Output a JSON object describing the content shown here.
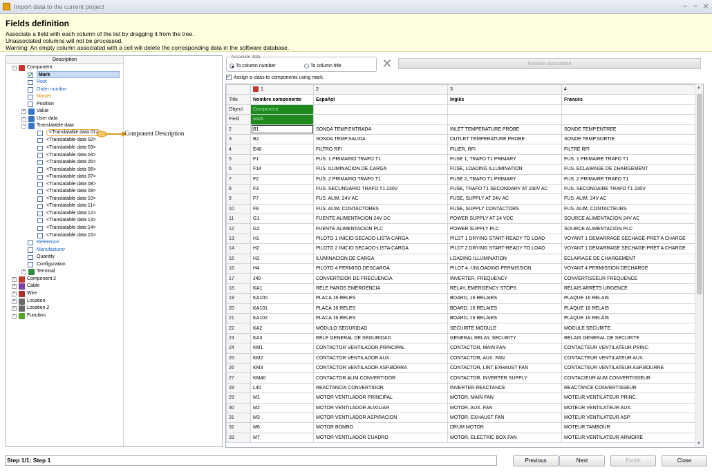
{
  "window": {
    "title": "Import data to the current project",
    "controls": [
      "–",
      "▫",
      "✕"
    ]
  },
  "header": {
    "title": "Fields definition",
    "lines": [
      "Associate a field with each column of the list by dragging it from the tree.",
      "Unassociated columns will not be processed.",
      "Warning: An empty column associated with a cell will delete the corresponding data in the software database."
    ]
  },
  "tree": {
    "column_header": "Description",
    "items": [
      {
        "label": "Component",
        "level": 0,
        "exp": "−",
        "icon": "component-icon",
        "color": "#c0392b"
      },
      {
        "label": "Mark",
        "level": 1,
        "cb": "checked",
        "style": "sel"
      },
      {
        "label": "Root",
        "level": 1,
        "cb": "empty",
        "style": "blue"
      },
      {
        "label": "Order number",
        "level": 1,
        "cb": "empty",
        "style": "blue"
      },
      {
        "label": "Master",
        "level": 1,
        "cb": "empty",
        "style": "orange"
      },
      {
        "label": "Position",
        "level": 1,
        "cb": "empty"
      },
      {
        "label": "Value",
        "level": 1,
        "exp": "+",
        "icon": "folder-icon",
        "color": "#3a74c6"
      },
      {
        "label": "User data",
        "level": 1,
        "exp": "+",
        "icon": "folder-icon",
        "color": "#3a74c6"
      },
      {
        "label": "Translatable data",
        "level": 1,
        "exp": "−",
        "icon": "folder-icon",
        "color": "#3a74c6"
      },
      {
        "label": "<Translatable data 01>",
        "level": 2,
        "cb": "empty",
        "style": "outlined"
      },
      {
        "label": "<Translatable data 02>",
        "level": 2,
        "cb": "empty"
      },
      {
        "label": "<Translatable data 03>",
        "level": 2,
        "cb": "empty"
      },
      {
        "label": "<Translatable data 04>",
        "level": 2,
        "cb": "empty"
      },
      {
        "label": "<Translatable data 05>",
        "level": 2,
        "cb": "empty"
      },
      {
        "label": "<Translatable data 06>",
        "level": 2,
        "cb": "empty"
      },
      {
        "label": "<Translatable data 07>",
        "level": 2,
        "cb": "empty"
      },
      {
        "label": "<Translatable data 08>",
        "level": 2,
        "cb": "empty"
      },
      {
        "label": "<Translatable data 09>",
        "level": 2,
        "cb": "empty"
      },
      {
        "label": "<Translatable data 10>",
        "level": 2,
        "cb": "empty"
      },
      {
        "label": "<Translatable data 11>",
        "level": 2,
        "cb": "empty"
      },
      {
        "label": "<Translatable data 12>",
        "level": 2,
        "cb": "empty"
      },
      {
        "label": "<Translatable data 13>",
        "level": 2,
        "cb": "empty"
      },
      {
        "label": "<Translatable data 14>",
        "level": 2,
        "cb": "empty"
      },
      {
        "label": "<Translatable data 15>",
        "level": 2,
        "cb": "empty"
      },
      {
        "label": "Reference",
        "level": 1,
        "cb": "empty",
        "style": "blue"
      },
      {
        "label": "Manufacturer",
        "level": 1,
        "cb": "empty",
        "style": "blue"
      },
      {
        "label": "Quantity",
        "level": 1,
        "cb": "empty"
      },
      {
        "label": "Configuration",
        "level": 1,
        "cb": "empty"
      },
      {
        "label": "Terminal",
        "level": 1,
        "exp": "+",
        "icon": "terminal-icon",
        "color": "#2f8a3c"
      },
      {
        "label": "Component 2",
        "level": 0,
        "exp": "+",
        "icon": "component-icon",
        "color": "#c0392b"
      },
      {
        "label": "Cable",
        "level": 0,
        "exp": "+",
        "icon": "cable-icon",
        "color": "#7a3fa0"
      },
      {
        "label": "Wire",
        "level": 0,
        "exp": "+",
        "icon": "wire-icon",
        "color": "#b03030"
      },
      {
        "label": "Location",
        "level": 0,
        "exp": "+",
        "icon": "location-icon",
        "color": "#6a6a6a"
      },
      {
        "label": "Location 2",
        "level": 0,
        "exp": "+",
        "icon": "location-icon",
        "color": "#6a6a6a"
      },
      {
        "label": "Function",
        "level": 0,
        "exp": "+",
        "icon": "function-icon",
        "color": "#5aa02c"
      }
    ],
    "callout": "Component Description"
  },
  "associate": {
    "legend": "Associate data",
    "opt_number": "To column number",
    "opt_title": "To column title",
    "selected": "number",
    "remove": "Remove association",
    "assign_class": "Assign a class to components using mark."
  },
  "grid": {
    "header": [
      "",
      "1",
      "2",
      "3",
      "4"
    ],
    "title_row": [
      "Title",
      "Nombre componente",
      "Español",
      "Inglés",
      "Francés"
    ],
    "object_row": [
      "Object",
      "Component",
      "",
      "",
      ""
    ],
    "field_row": [
      "Field",
      "Mark",
      "",
      "",
      ""
    ],
    "rows": [
      [
        "2",
        "B1",
        "SONDA TEMP.ENTRADA",
        "INLET TEMPERATURE PROBE",
        "SONDE TEMP.ENTREE"
      ],
      [
        "3",
        "B2",
        "SONDA TEMP.SALIDA",
        "OUTLET TEMPERATURE PROBE",
        "SONDE TEMP.SORTIE"
      ],
      [
        "4",
        "E40",
        "FILTRO RFI",
        "FILIER, RFI",
        "FILTRE RFI"
      ],
      [
        "5",
        "F1",
        "FUS. 1 PRIMARIO TRAFO T1",
        "FUSE 1, TRAFO T1 PRIMARY",
        "FUS. 1 PRIMAIRE TRAFO T1"
      ],
      [
        "6",
        "F14",
        "FUS. ILUMINACION DE CARGA",
        "FUSE, LOADING ILLUMINATION",
        "FUS. ECLAIRAGE DE CHARGEMENT"
      ],
      [
        "7",
        "F2",
        "FUS. 2 PRIMARIO TRAFO T1",
        "FUSE 2, TRAFO T1 PRIMARY",
        "FUS. 2 PRIMAIRE TRAFO T1"
      ],
      [
        "8",
        "F3",
        "FUS. SECUNDARIO TRAFO T1 230V",
        "FUSE, TRAFO T1 SECONDARY AT 230V AC",
        "FUS. SECONDAIRE TRAFO T1 230V"
      ],
      [
        "9",
        "F7",
        "FUS. ALIM. 24V AC",
        "FUSE, SUPPLY AT 24V AC",
        "FUS. ALIM. 24V AC"
      ],
      [
        "10",
        "F8",
        "FUS. ALIM. CONTACTORES",
        "FUSE, SUPPLY CONTACTORS",
        "FUS. ALIM. CONTACTEURS"
      ],
      [
        "11",
        "G1",
        "FUENTE ALIMENTACION 24V DC",
        "POWER SUPPLY AT 24 VDC",
        "SOURCE ALIMENTACION 24V AC"
      ],
      [
        "12",
        "G2",
        "FUENTE ALIMENTACION PLC",
        "POWER SUPPLY PLC",
        "SOURCE ALIMENTACION PLC"
      ],
      [
        "13",
        "H1",
        "PILOTO 1 INICIO SECADO-LISTA CARGA",
        "PILDT 1 DRYING START-READY TO LOAD",
        "VOYANT 1 DEMARRAGE SECHAGE-PRET A CHARGE"
      ],
      [
        "14",
        "H2",
        "PILOTO 2 INICIO SECADO-LISTA CARGA",
        "PILDT 2 DRYING START-READY TO LOAD",
        "VOYANT 1 DEMARRAGE SECHAGE-PRET A CHARGE"
      ],
      [
        "15",
        "H3",
        "ILUMINACION DE CARGA",
        "LOADING ILLUMINATION",
        "ECLAIRAGE DE CHARGEMENT"
      ],
      [
        "16",
        "H4",
        "PILOTO 4 PERMISO DESCARGA",
        "PILOT 4, UNLOADING PERMISSION",
        "VOYANT 4 PERMISSION DECHARGE"
      ],
      [
        "17",
        "J40",
        "CONVERTIDOR DE FRECUENCIA",
        "INVERTER, FREQUENCY",
        "CONVERTISSEUR FREQUENCE"
      ],
      [
        "18",
        "KA1",
        "RELE PAROS EMERGENCIA",
        "RELAY, EMERGENCY STOPS",
        "RELAIS ARRETS URGENCE"
      ],
      [
        "19",
        "KA100",
        "PLACA 16 RELES",
        "BOARD, 16 RELAIES",
        "PLAQUE 16 RELAIS"
      ],
      [
        "20",
        "KA101",
        "PLACA 16 RELES",
        "BOARD, 16 RELAIES",
        "PLAQUE 16 RELAIS"
      ],
      [
        "21",
        "KA102",
        "PLACA 16 RELES",
        "BOARD, 16 RELAIES",
        "PLAQUE 16 RELAIS"
      ],
      [
        "22",
        "KA2",
        "MODULO SEGURIDAD",
        "SECURITE MODULE",
        "MODULE SECURITE"
      ],
      [
        "23",
        "KA3",
        "RELE GENERAL DE SEGURIDAD",
        "GENERAL RELAY, SECURITY",
        "RELAIS GENERAL DE SECURITE"
      ],
      [
        "24",
        "KM1",
        "CONTACTOR VENTILADOR PRINCIPAL",
        "CONTACTOR, MAIN FAN",
        "CONTACTEUR VENTILATEUR PRINC."
      ],
      [
        "25",
        "KM2",
        "CONTACTOR VENTILADOR AUX.",
        "CONTACTOR, AUX. FAN",
        "CONTACTEUR VENTILATEUR AUX."
      ],
      [
        "26",
        "KM3",
        "CONTACTOR VENTILADOR ASP.BORRA",
        "CONTACTOR, LINT EXHAUST FAN",
        "CONTACTEUR VENTILATEUR ASP.BOURRE"
      ],
      [
        "27",
        "KM40",
        "CONTACTOR ALIM.CONVERTIDOR",
        "CONTACTOR, INVERTER SUPPLY",
        "CONTACIEUR AUM.CONVERTISSEUR"
      ],
      [
        "28",
        "L40",
        "REACTANCIA CONVERTIDOR",
        "INVERTER REACTANCE",
        "REACTANCE CONVERTISSEUR"
      ],
      [
        "29",
        "M1",
        "MOTOR VENTILADOR PRINCIPAL",
        "MOTOR, MAIN FAN",
        "MOTEUR VENTILATEUR PRINC."
      ],
      [
        "30",
        "M2",
        "MOTOR VENTILADOR AUXILIAR",
        "MOTOR, AUX. FAN",
        "MOTEUR VENTILATEUR AUX."
      ],
      [
        "31",
        "M3",
        "MOTOR VENTILADOR ASPIRACION",
        "MOTOR, EXHAUST FAN",
        "MOTEUR VENTILATEUR ASP."
      ],
      [
        "32",
        "M6",
        "MOTOR BOMBO",
        "DRUM MOTOR",
        "MOTEUR TAMBOUR"
      ],
      [
        "33",
        "M7",
        "MOTOR VENTILADOR CUADRO",
        "MOTOR, ELECTRIC BOX FAN",
        "MOTEUR VENTILATEUR ARMOIRE"
      ]
    ]
  },
  "footer": {
    "status": "Step 1/1: Step 1",
    "previous": "Previous",
    "next": "Next",
    "finish": "Finish",
    "close": "Close"
  },
  "colors": {
    "header_bg": "#ffffe0",
    "assoc_green": "#1e8a1e",
    "link_blue": "#1c5fc4",
    "master_orange": "#d98a00"
  }
}
